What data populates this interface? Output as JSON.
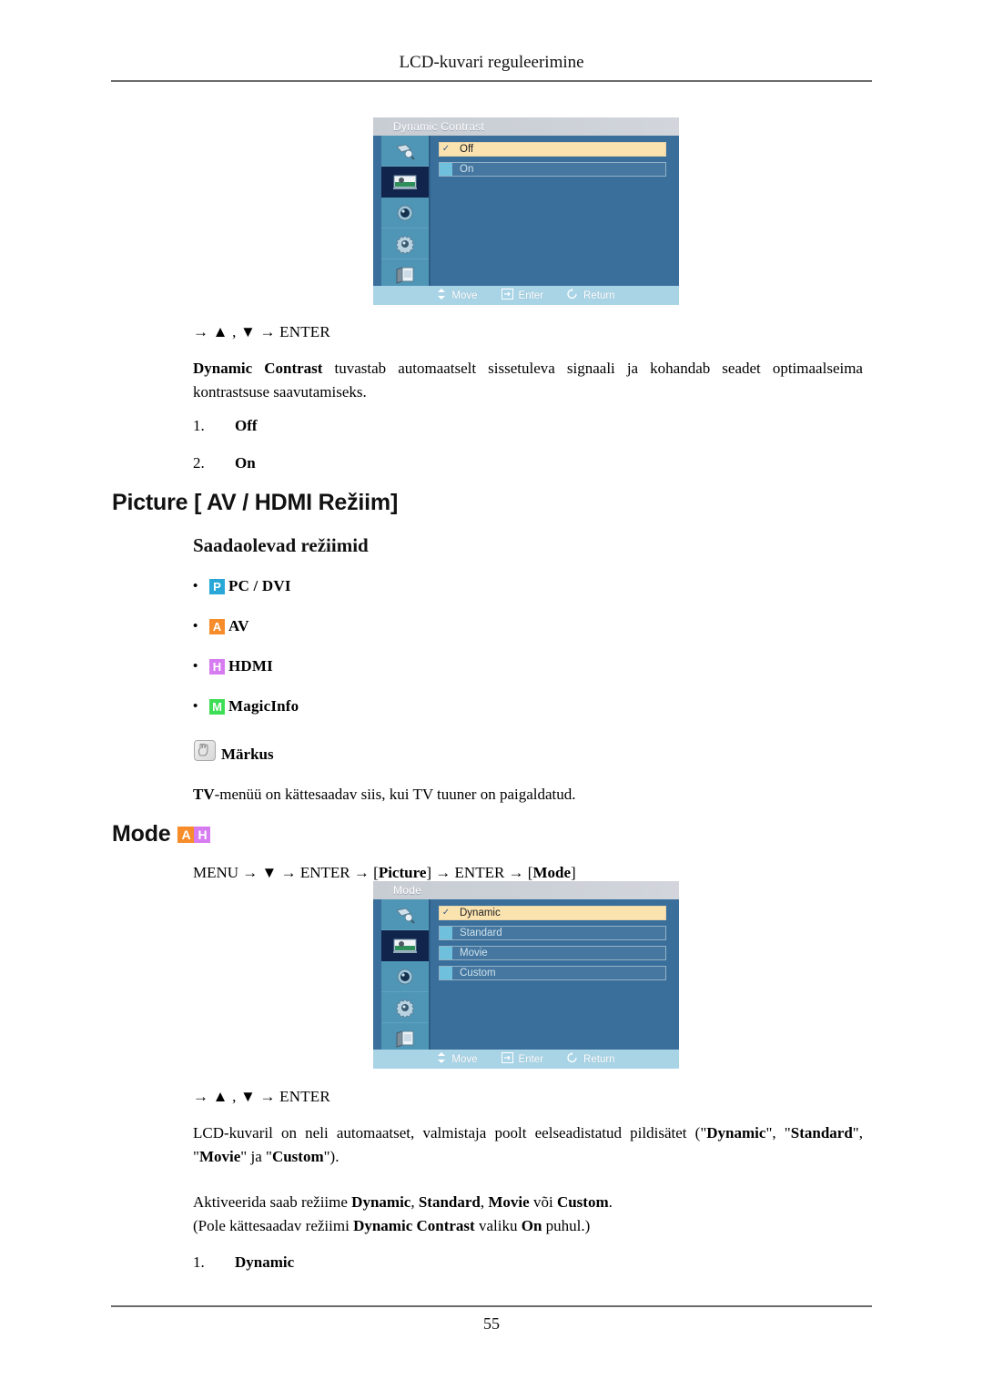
{
  "page": {
    "running_header": "LCD-kuvari reguleerimine",
    "page_number": "55"
  },
  "osd_dynamic_contrast": {
    "title": "Dynamic Contrast",
    "items": [
      {
        "label": "Off",
        "selected": true
      },
      {
        "label": "On",
        "selected": false
      }
    ],
    "footer": [
      {
        "icon": "move-icon",
        "label": "Move"
      },
      {
        "icon": "enter-icon",
        "label": "Enter"
      },
      {
        "icon": "return-icon",
        "label": "Return"
      }
    ],
    "sidebar_icons": [
      "input-icon",
      "picture-icon",
      "sound-icon",
      "setup-icon",
      "multi-control-icon"
    ],
    "active_sidebar_index": 1,
    "colors": {
      "background": "#3a6f9b",
      "sidebar": "#4f95b6",
      "sidebar_active": "#11254c",
      "selected_row": "#fbe3b0",
      "footer": "#a8d4e6"
    }
  },
  "dynamic_contrast_section": {
    "nav_hint": "→ ▲ , ▼ → ENTER",
    "description_bold": "Dynamic Contrast",
    "description_rest": " tuvastab automaatselt sissetuleva signaali ja kohandab seadet optimaalseima kontrastsuse saavutamiseks.",
    "options": [
      {
        "num": "1.",
        "value": "Off"
      },
      {
        "num": "2.",
        "value": "On"
      }
    ]
  },
  "picture_section": {
    "heading": "Picture [ AV / HDMI Režiim]",
    "subheading": "Saadaolevad režiimid",
    "modes": [
      {
        "badge": "P",
        "badge_class": "p",
        "badge_color": "#29a8d8",
        "name": "PC / DVI"
      },
      {
        "badge": "A",
        "badge_class": "a",
        "badge_color": "#f68c2a",
        "name": "AV"
      },
      {
        "badge": "H",
        "badge_class": "h",
        "badge_color": "#d77cf0",
        "name": "HDMI"
      },
      {
        "badge": "M",
        "badge_class": "m",
        "badge_color": "#3ddd55",
        "name": "MagicInfo"
      }
    ],
    "note": {
      "icon": "note-hand-icon",
      "title": "Märkus",
      "text_bold": "TV",
      "text_rest": "-menüü on kättesaadav siis, kui TV tuuner on paigaldatud."
    }
  },
  "mode_section": {
    "heading": "Mode",
    "heading_badges": [
      {
        "badge": "A",
        "badge_class": "a",
        "badge_color": "#f68c2a"
      },
      {
        "badge": "H",
        "badge_class": "h",
        "badge_color": "#d77cf0"
      }
    ],
    "menu_path_plain_1": "MENU → ▼ → ENTER → [",
    "menu_path_bold_1": "Picture",
    "menu_path_plain_2": "] → ENTER → [",
    "menu_path_bold_2": "Mode",
    "menu_path_plain_3": "]",
    "nav_hint": "→ ▲ , ▼ → ENTER",
    "para1_a": "LCD-kuvaril on neli automaatset, valmistaja poolt eelseadistatud pildisätet (\"",
    "para1_b1": "Dynamic",
    "para1_c": "\", \"",
    "para1_b2": "Standard",
    "para1_d": "\", \"",
    "para1_b3": "Movie",
    "para1_e": "\" ja \"",
    "para1_b4": "Custom",
    "para1_f": "\").",
    "para2_a": "Aktiveerida saab režiime  ",
    "para2_b1": "Dynamic",
    "para2_c": ", ",
    "para2_b2": "Standard",
    "para2_d": ", ",
    "para2_b3": "Movie",
    "para2_e": " või ",
    "para2_b4": "Custom",
    "para2_f": ".",
    "para3_a": "(Pole kättesaadav režiimi ",
    "para3_b1": "Dynamic Contrast",
    "para3_c": " valiku ",
    "para3_b2": "On",
    "para3_d": " puhul.)",
    "options": [
      {
        "num": "1.",
        "value": "Dynamic"
      }
    ]
  },
  "osd_mode": {
    "title": "Mode",
    "items": [
      {
        "label": "Dynamic",
        "selected": true
      },
      {
        "label": "Standard",
        "selected": false
      },
      {
        "label": "Movie",
        "selected": false
      },
      {
        "label": "Custom",
        "selected": false
      }
    ],
    "footer": [
      {
        "icon": "move-icon",
        "label": "Move"
      },
      {
        "icon": "enter-icon",
        "label": "Enter"
      },
      {
        "icon": "return-icon",
        "label": "Return"
      }
    ],
    "sidebar_icons": [
      "input-icon",
      "picture-icon",
      "sound-icon",
      "setup-icon",
      "multi-control-icon"
    ],
    "active_sidebar_index": 1
  }
}
